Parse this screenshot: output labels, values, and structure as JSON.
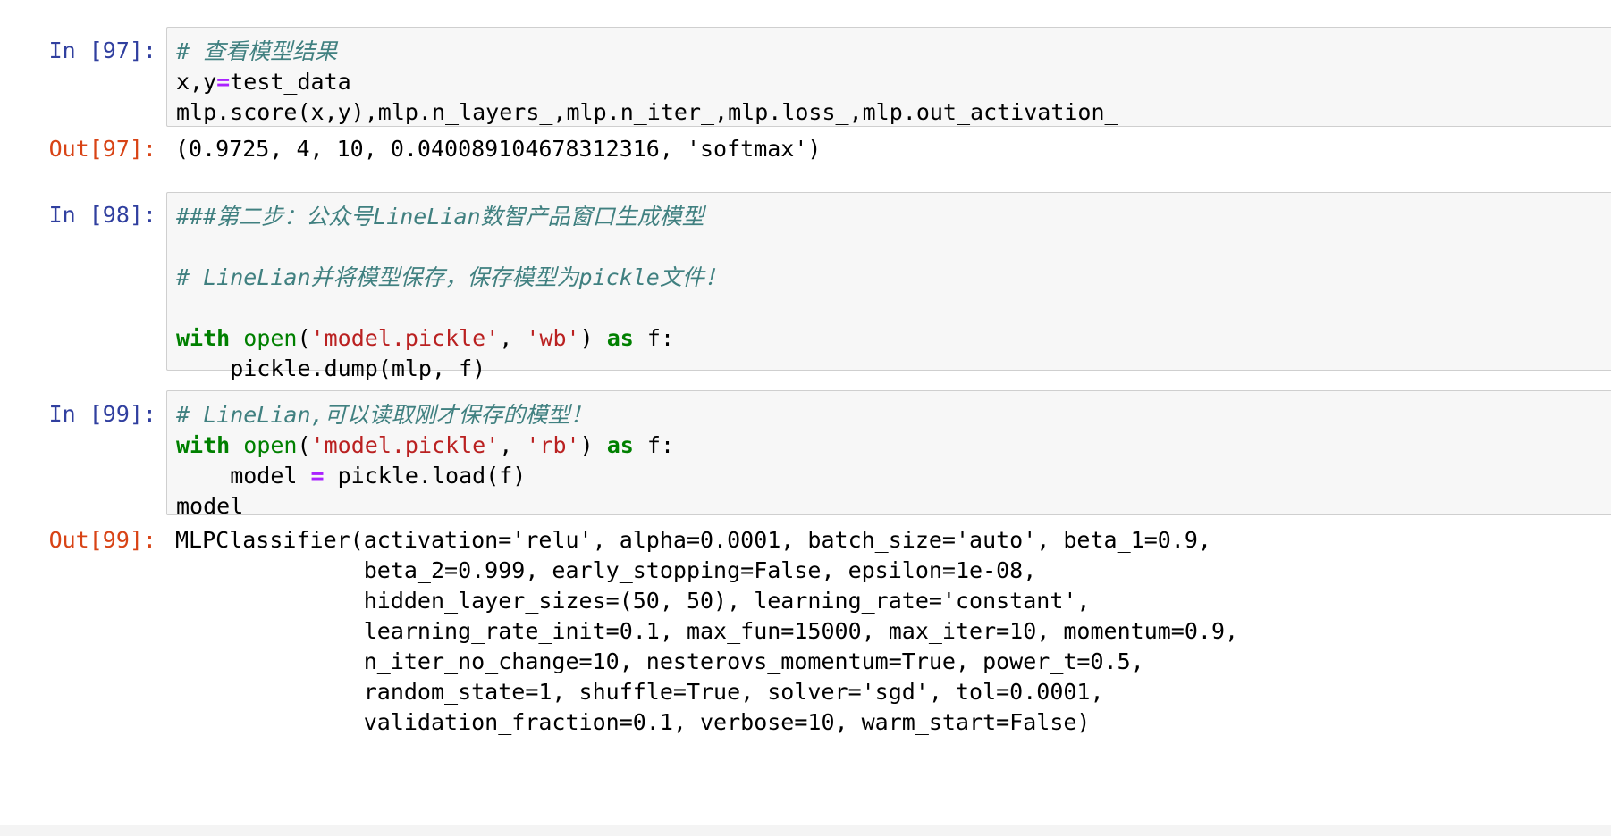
{
  "cells": [
    {
      "in_prompt": "In [97]:",
      "code": {
        "line1_comment": "# 查看模型结果",
        "line2_a": "x,y",
        "line2_eq": "=",
        "line2_b": "test_data",
        "line3": "mlp.score(x,y),mlp.n_layers_,mlp.n_iter_,mlp.loss_,mlp.out_activation_"
      },
      "out_prompt": "Out[97]:",
      "output": "(0.9725, 4, 10, 0.040089104678312316, 'softmax')"
    },
    {
      "in_prompt": "In [98]:",
      "code": {
        "line1_comment": "###第二步：公众号LineLian数智产品窗口生成模型",
        "line3_comment": "# LineLian并将模型保存，保存模型为pickle文件！",
        "with_kw": "with",
        "open_fn": "open",
        "paren_open": "(",
        "str1": "'model.pickle'",
        "comma": ", ",
        "str2": "'wb'",
        "paren_close": ")",
        "as_kw": "as",
        "target": " f:",
        "body": "    pickle.dump(mlp, f)"
      }
    },
    {
      "in_prompt": "In [99]:",
      "code": {
        "line1_comment": "# LineLian,可以读取刚才保存的模型！",
        "with_kw": "with",
        "open_fn": "open",
        "paren_open": "(",
        "str1": "'model.pickle'",
        "comma": ", ",
        "str2": "'rb'",
        "paren_close": ")",
        "as_kw": "as",
        "target": " f:",
        "body_a": "    model ",
        "body_eq": "=",
        "body_b": " pickle.load(f)",
        "line4": "model"
      },
      "out_prompt": "Out[99]:",
      "output_lines": [
        "MLPClassifier(activation='relu', alpha=0.0001, batch_size='auto', beta_1=0.9,",
        "              beta_2=0.999, early_stopping=False, epsilon=1e-08,",
        "              hidden_layer_sizes=(50, 50), learning_rate='constant',",
        "              learning_rate_init=0.1, max_fun=15000, max_iter=10, momentum=0.9,",
        "              n_iter_no_change=10, nesterovs_momentum=True, power_t=0.5,",
        "              random_state=1, shuffle=True, solver='sgd', tol=0.0001,",
        "              validation_fraction=0.1, verbose=10, warm_start=False)"
      ]
    }
  ],
  "colors": {
    "in_prompt": "#303F9F",
    "out_prompt": "#D84315",
    "comment": "#408080",
    "keyword": "#008000",
    "string": "#BA2121",
    "operator": "#AA22FF",
    "cell_bg": "#f7f7f7",
    "cell_border": "#cfcfcf"
  }
}
